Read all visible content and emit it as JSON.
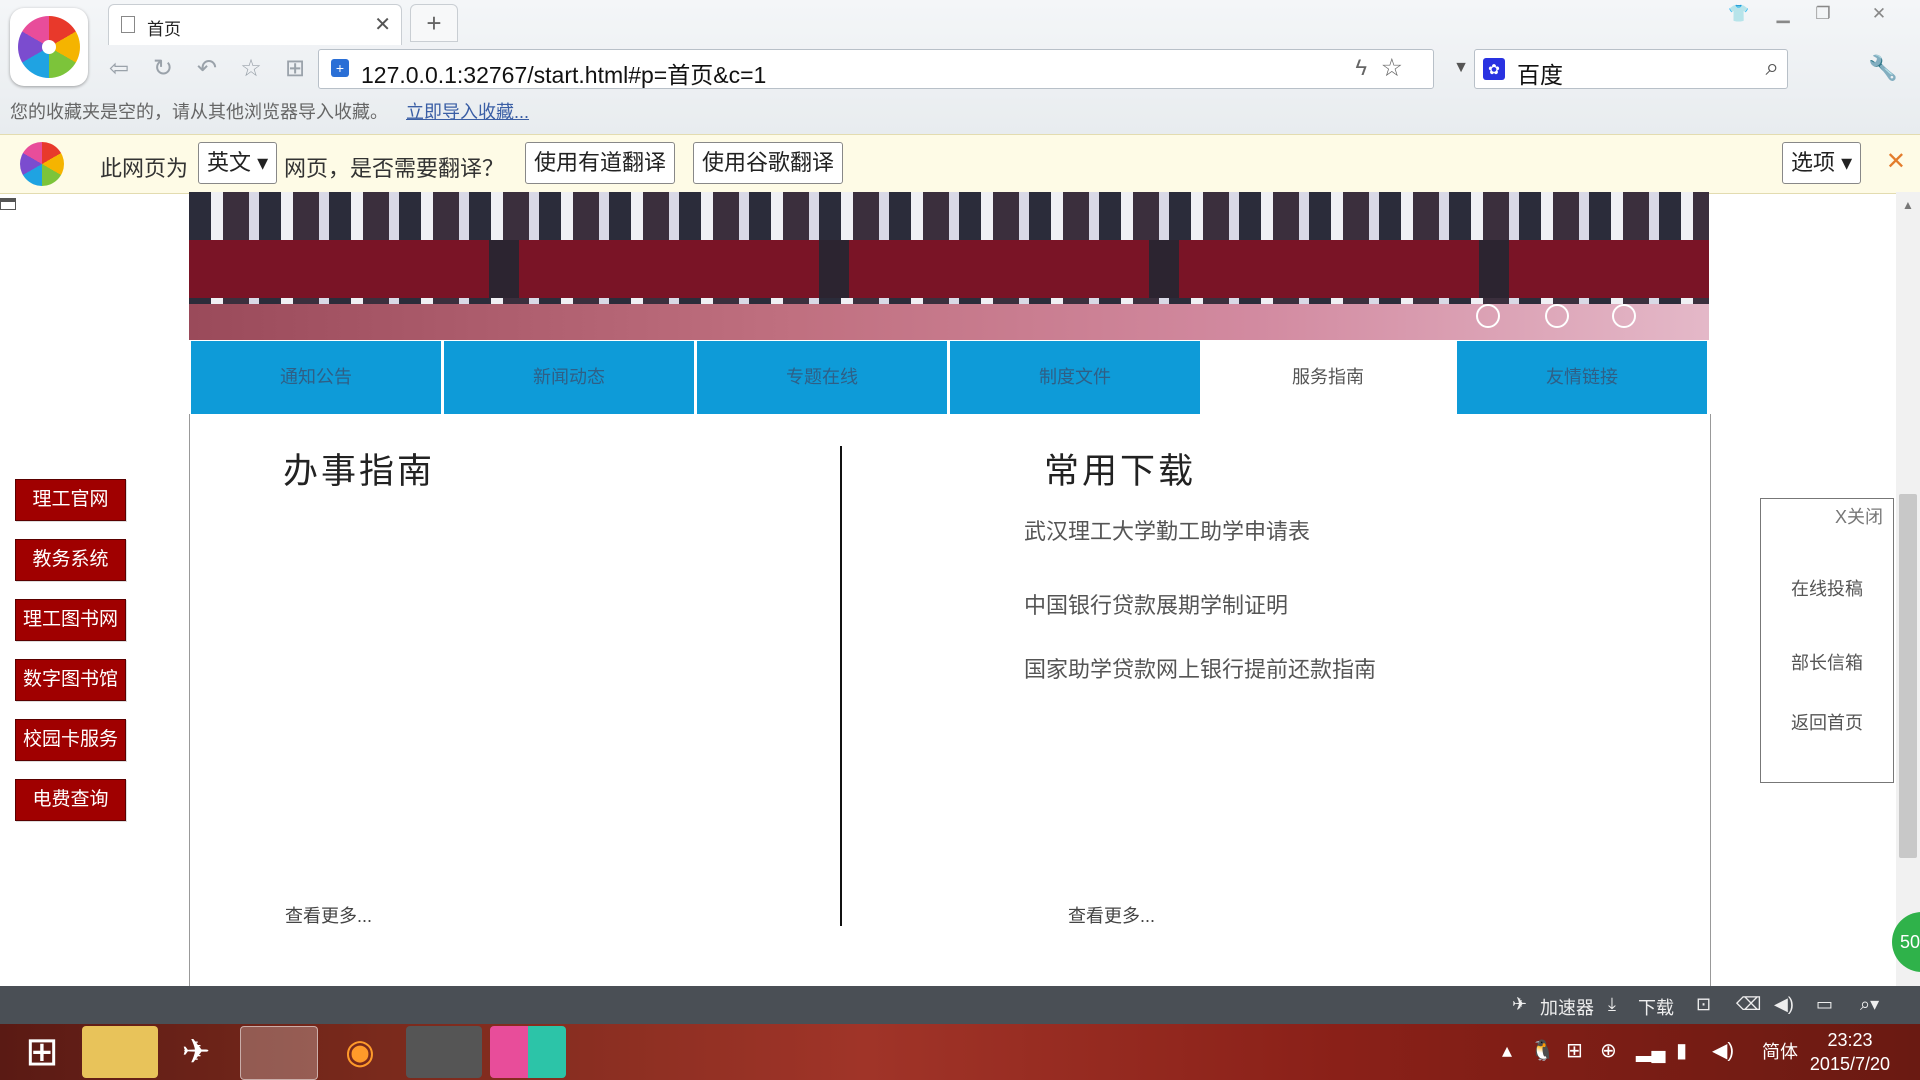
{
  "browser": {
    "tab_title": "首页",
    "new_tab": "+",
    "address": "127.0.0.1:32767/start.html#p=首页&c=1",
    "search_engine": "百度",
    "favorites_empty": "您的收藏夹是空的，请从其他浏览器导入收藏。",
    "import_link": "立即导入收藏..."
  },
  "translate_bar": {
    "prefix": "此网页为",
    "language": "英文",
    "suffix": "网页，是否需要翻译？",
    "youdao": "使用有道翻译",
    "google": "使用谷歌翻译",
    "options": "选项"
  },
  "nav": {
    "tabs": [
      "通知公告",
      "新闻动态",
      "专题在线",
      "制度文件",
      "服务指南",
      "友情链接"
    ],
    "active_index": 4
  },
  "guide": {
    "title": "办事指南",
    "more": "查看更多..."
  },
  "downloads": {
    "title": "常用下载",
    "items": [
      "武汉理工大学勤工助学申请表",
      "中国银行贷款展期学制证明",
      "国家助学贷款网上银行提前还款指南"
    ],
    "more": "查看更多..."
  },
  "quick_links": [
    "理工官网",
    "教务系统",
    "理工图书网",
    "数字图书馆",
    "校园卡服务",
    "电费查询"
  ],
  "float_box": {
    "close": "X关闭",
    "items": [
      "在线投稿",
      "部长信箱",
      "返回首页"
    ]
  },
  "badge": "50",
  "statusbar": {
    "accelerator": "加速器",
    "download": "下载"
  },
  "taskbar": {
    "ime": "简体",
    "time": "23:23",
    "date": "2015/7/20"
  }
}
